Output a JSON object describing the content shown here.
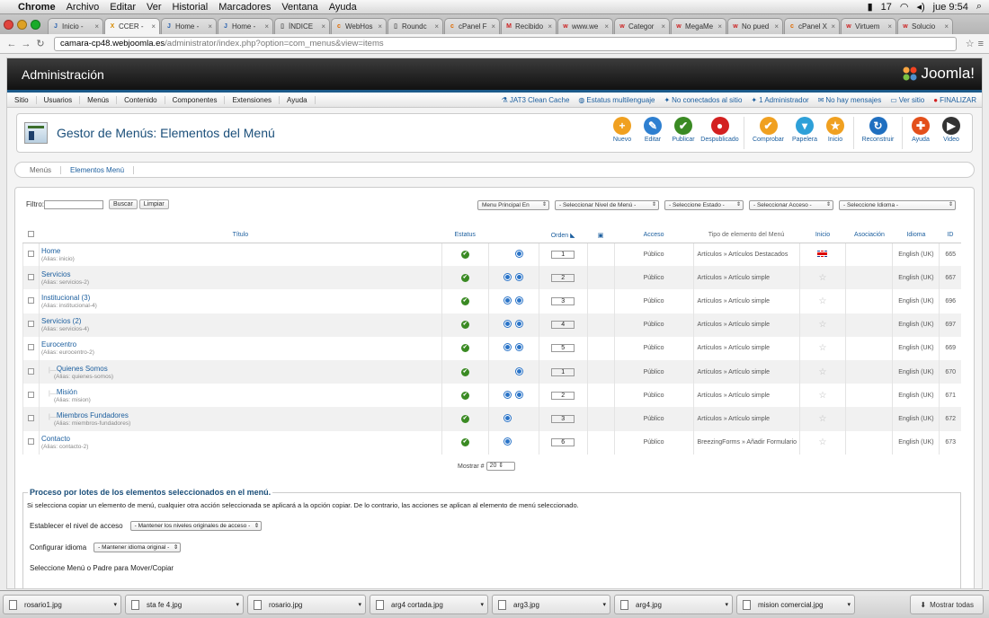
{
  "macmenu": {
    "app": "Chrome",
    "items": [
      "Archivo",
      "Editar",
      "Ver",
      "Historial",
      "Marcadores",
      "Ventana",
      "Ayuda"
    ],
    "battery_num": "17",
    "clock": "jue 9:54"
  },
  "tabs": [
    {
      "label": "Inicio -",
      "active": false,
      "fav": "J",
      "color": "#2b63b0"
    },
    {
      "label": "CCER -",
      "active": true,
      "fav": "X",
      "color": "#d68a00"
    },
    {
      "label": "Home -",
      "active": false,
      "fav": "J",
      "color": "#2b63b0"
    },
    {
      "label": "Home -",
      "active": false,
      "fav": "J",
      "color": "#2b63b0"
    },
    {
      "label": "ÍNDICE",
      "active": false,
      "fav": "▯",
      "color": "#555"
    },
    {
      "label": "WebHos",
      "active": false,
      "fav": "c",
      "color": "#e06b00"
    },
    {
      "label": "Roundc",
      "active": false,
      "fav": "▯",
      "color": "#555"
    },
    {
      "label": "cPanel F",
      "active": false,
      "fav": "c",
      "color": "#e06b00"
    },
    {
      "label": "Recibido",
      "active": false,
      "fav": "M",
      "color": "#c22"
    },
    {
      "label": "www.we",
      "active": false,
      "fav": "w",
      "color": "#c22"
    },
    {
      "label": "Categor",
      "active": false,
      "fav": "w",
      "color": "#c22"
    },
    {
      "label": "MegaMe",
      "active": false,
      "fav": "w",
      "color": "#c22"
    },
    {
      "label": "No pued",
      "active": false,
      "fav": "w",
      "color": "#c22"
    },
    {
      "label": "cPanel X",
      "active": false,
      "fav": "c",
      "color": "#e06b00"
    },
    {
      "label": "Virtuem",
      "active": false,
      "fav": "w",
      "color": "#c22"
    },
    {
      "label": "Solucio",
      "active": false,
      "fav": "w",
      "color": "#c22"
    }
  ],
  "url": {
    "host": "camara-cp48.webjoomla.es",
    "path": "/administrator/index.php?option=com_menus&view=items"
  },
  "header": {
    "title": "Administración",
    "logo": "Joomla!"
  },
  "menubar": {
    "items": [
      "Sitio",
      "Usuarios",
      "Menús",
      "Contenido",
      "Componentes",
      "Extensiones",
      "Ayuda"
    ],
    "status": [
      {
        "icon": "⚗",
        "label": "JAT3 Clean Cache"
      },
      {
        "icon": "◍",
        "label": "Estatus multilenguaje"
      },
      {
        "icon": "✦",
        "label": "No conectados al sitio"
      },
      {
        "icon": "✦",
        "label": "1 Administrador"
      },
      {
        "icon": "✉",
        "label": "No hay mensajes"
      },
      {
        "icon": "▭",
        "label": "Ver sitio"
      },
      {
        "icon": "●",
        "label": "FINALIZAR"
      }
    ]
  },
  "toolbar": {
    "title": "Gestor de Menús: Elementos del Menú",
    "buttons": [
      {
        "label": "Nuevo",
        "icon": "+",
        "color": "#f0a020"
      },
      {
        "label": "Editar",
        "icon": "✎",
        "color": "#2e7fd0"
      },
      {
        "label": "Publicar",
        "icon": "✔",
        "color": "#3a8a23"
      },
      {
        "label": "Despublicado",
        "icon": "●",
        "color": "#d32020"
      },
      {
        "label": "Comprobar",
        "icon": "✔",
        "color": "#f0a020"
      },
      {
        "label": "Papelera",
        "icon": "▾",
        "color": "#2ea0d8"
      },
      {
        "label": "Inicio",
        "icon": "★",
        "color": "#f0a020"
      },
      {
        "label": "Reconstruir",
        "icon": "↻",
        "color": "#1f6fc0"
      },
      {
        "label": "Ayuda",
        "icon": "✚",
        "color": "#e34f1a"
      },
      {
        "label": "Video",
        "icon": "▶",
        "color": "#333"
      }
    ]
  },
  "subtabs": [
    "Menús",
    "Elementos Menú"
  ],
  "filter": {
    "label": "Filtro:",
    "search": "Buscar",
    "clear": "Limpiar"
  },
  "selects": [
    "Menu Principal En",
    "- Seleccionar Nivel de Menú -",
    "- Seleccione Estado -",
    "- Seleccionar Acceso -",
    "- Seleccione Idioma -"
  ],
  "columns": {
    "title": "Título",
    "status": "Estatus",
    "order": "Orden",
    "access": "Acceso",
    "type": "Tipo de elemento del Menú",
    "home": "Inicio",
    "assoc": "Asociación",
    "lang": "Idioma",
    "id": "ID"
  },
  "rows": [
    {
      "title": "Home",
      "alias": "(Alias: inicio)",
      "up": false,
      "down": true,
      "order": "1",
      "access": "Público",
      "type": "Artículos » Artículos Destacados",
      "home": "flag",
      "lang": "English (UK)",
      "id": "665",
      "child": false
    },
    {
      "title": "Servicios",
      "alias": "(Alias: servicios-2)",
      "up": true,
      "down": true,
      "order": "2",
      "access": "Público",
      "type": "Artículos » Artículo simple",
      "home": "star",
      "lang": "English (UK)",
      "id": "667",
      "child": false
    },
    {
      "title": "Institucional (3)",
      "alias": "(Alias: institucional-4)",
      "up": true,
      "down": true,
      "order": "3",
      "access": "Público",
      "type": "Artículos » Artículo simple",
      "home": "star",
      "lang": "English (UK)",
      "id": "696",
      "child": false
    },
    {
      "title": "Servicios (2)",
      "alias": "(Alias: servicios-4)",
      "up": true,
      "down": true,
      "order": "4",
      "access": "Público",
      "type": "Artículos » Artículo simple",
      "home": "star",
      "lang": "English (UK)",
      "id": "697",
      "child": false
    },
    {
      "title": "Eurocentro",
      "alias": "(Alias: eurocentro-2)",
      "up": true,
      "down": true,
      "order": "5",
      "access": "Público",
      "type": "Artículos » Artículo simple",
      "home": "star",
      "lang": "English (UK)",
      "id": "669",
      "child": false
    },
    {
      "title": "Quienes Somos",
      "alias": "(Alias: quienes-somos)",
      "up": false,
      "down": true,
      "order": "1",
      "access": "Público",
      "type": "Artículos » Artículo simple",
      "home": "star",
      "lang": "English (UK)",
      "id": "670",
      "child": true
    },
    {
      "title": "Misión",
      "alias": "(Alias: mision)",
      "up": true,
      "down": true,
      "order": "2",
      "access": "Público",
      "type": "Artículos » Artículo simple",
      "home": "star",
      "lang": "English (UK)",
      "id": "671",
      "child": true
    },
    {
      "title": "Miembros Fundadores",
      "alias": "(Alias: miembros-fundadores)",
      "up": true,
      "down": false,
      "order": "3",
      "access": "Público",
      "type": "Artículos » Artículo simple",
      "home": "star",
      "lang": "English (UK)",
      "id": "672",
      "child": true
    },
    {
      "title": "Contacto",
      "alias": "(Alias: contacto-2)",
      "up": true,
      "down": false,
      "order": "6",
      "access": "Público",
      "type": "BreezingForms » Añadir Formulario",
      "home": "star",
      "lang": "English (UK)",
      "id": "673",
      "child": false
    }
  ],
  "pagination": {
    "label": "Mostrar #",
    "value": "20"
  },
  "batch": {
    "legend": "Proceso por lotes de los elementos seleccionados en el menú.",
    "tip": "Si selecciona copiar un elemento de menú, cualquier otra acción seleccionada se aplicará a la opción copiar. De lo contrario, las acciones se aplican al elemento de menú seleccionado.",
    "access_label": "Establecer el nivel de acceso",
    "access_value": "- Mantener los niveles originales de acceso -",
    "lang_label": "Configurar idioma",
    "lang_value": "- Mantener idioma original -",
    "move_label": "Seleccione Menú o Padre para Mover/Copiar"
  },
  "downloads": [
    "rosario1.jpg",
    "sta fe 4.jpg",
    "rosario.jpg",
    "arg4 cortada.jpg",
    "arg3.jpg",
    "arg4.jpg",
    "mision comercial.jpg"
  ],
  "show_all": "Mostrar todas"
}
